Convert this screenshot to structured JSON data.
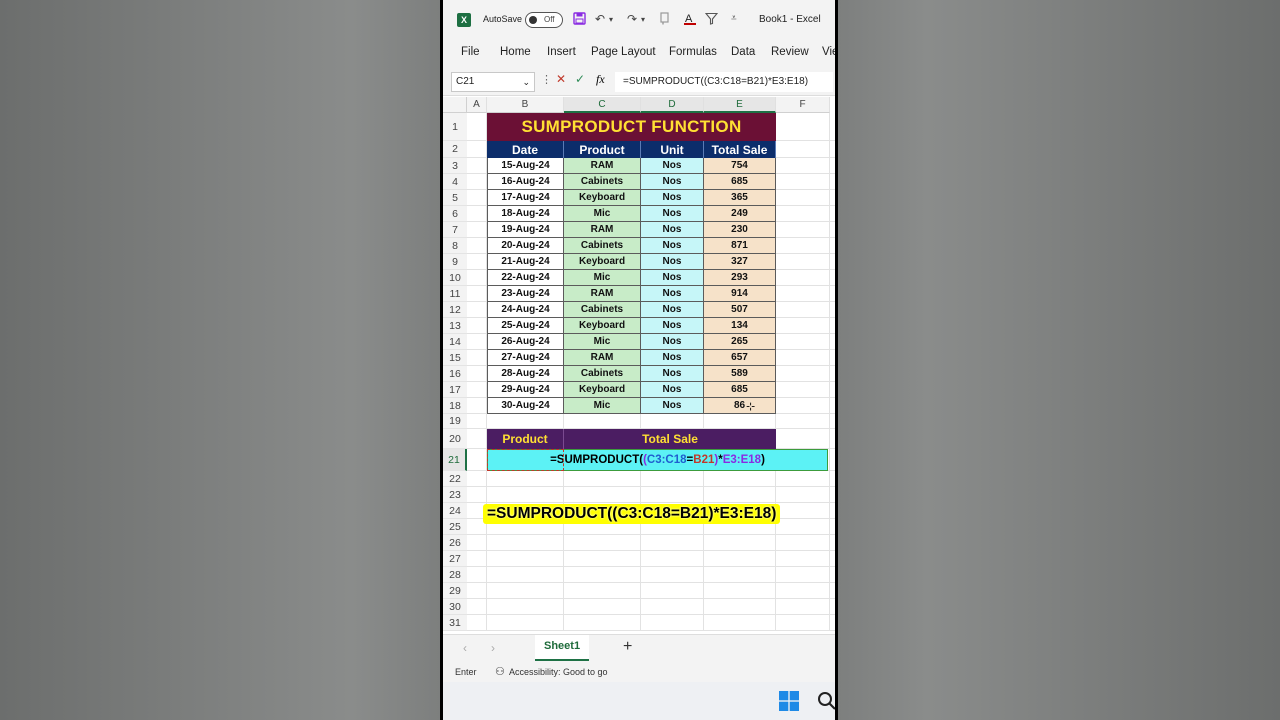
{
  "window": {
    "app_label": "X",
    "autosave_label": "AutoSave",
    "toggle_state": "Off",
    "title": "Book1  -  Excel"
  },
  "menu": [
    "File",
    "Home",
    "Insert",
    "Page Layout",
    "Formulas",
    "Data",
    "Review",
    "Vie"
  ],
  "formula_bar": {
    "name_box": "C21",
    "fx": "fx",
    "formula": "=SUMPRODUCT((C3:C18=B21)*E3:E18)"
  },
  "columns": [
    "A",
    "B",
    "C",
    "D",
    "E",
    "F"
  ],
  "rows": [
    "1",
    "2",
    "3",
    "4",
    "5",
    "6",
    "7",
    "8",
    "9",
    "10",
    "11",
    "12",
    "13",
    "14",
    "15",
    "16",
    "17",
    "18",
    "19",
    "20",
    "21",
    "22",
    "23",
    "24",
    "25",
    "26",
    "27",
    "28",
    "29",
    "30",
    "31"
  ],
  "sheet": {
    "title": "SUMPRODUCT FUNCTION",
    "headers": [
      "Date",
      "Product",
      "Unit",
      "Total Sale"
    ],
    "data": [
      [
        "15-Aug-24",
        "RAM",
        "Nos",
        "754"
      ],
      [
        "16-Aug-24",
        "Cabinets",
        "Nos",
        "685"
      ],
      [
        "17-Aug-24",
        "Keyboard",
        "Nos",
        "365"
      ],
      [
        "18-Aug-24",
        "Mic",
        "Nos",
        "249"
      ],
      [
        "19-Aug-24",
        "RAM",
        "Nos",
        "230"
      ],
      [
        "20-Aug-24",
        "Cabinets",
        "Nos",
        "871"
      ],
      [
        "21-Aug-24",
        "Keyboard",
        "Nos",
        "327"
      ],
      [
        "22-Aug-24",
        "Mic",
        "Nos",
        "293"
      ],
      [
        "23-Aug-24",
        "RAM",
        "Nos",
        "914"
      ],
      [
        "24-Aug-24",
        "Cabinets",
        "Nos",
        "507"
      ],
      [
        "25-Aug-24",
        "Keyboard",
        "Nos",
        "134"
      ],
      [
        "26-Aug-24",
        "Mic",
        "Nos",
        "265"
      ],
      [
        "27-Aug-24",
        "RAM",
        "Nos",
        "657"
      ],
      [
        "28-Aug-24",
        "Cabinets",
        "Nos",
        "589"
      ],
      [
        "29-Aug-24",
        "Keyboard",
        "Nos",
        "685"
      ],
      [
        "30-Aug-24",
        "Mic",
        "Nos",
        "86"
      ]
    ],
    "summary_headers": [
      "Product",
      "Total Sale"
    ],
    "formula_parts": [
      {
        "text": "=SUMPRODUCT(",
        "color": "#000000"
      },
      {
        "text": "(",
        "color": "#8a2be2"
      },
      {
        "text": "C3:C18",
        "color": "#1f5fcf"
      },
      {
        "text": "=",
        "color": "#000000"
      },
      {
        "text": "B21",
        "color": "#c0392b"
      },
      {
        "text": ")",
        "color": "#8a2be2"
      },
      {
        "text": "*",
        "color": "#000000"
      },
      {
        "text": "E3:E18",
        "color": "#8a2be2"
      },
      {
        "text": ")",
        "color": "#000000"
      }
    ],
    "overlay_formula": "=SUMPRODUCT((C3:C18=B21)*E3:E18)"
  },
  "sheet_tabs": {
    "active": "Sheet1",
    "add_label": "+"
  },
  "status": {
    "mode": "Enter",
    "accessibility": "Accessibility: Good to go"
  },
  "colors": {
    "title_bg": "#6b1035",
    "title_fg": "#ffe033",
    "header_bg": "#0c2d6b",
    "date_bg": "#ffffff",
    "product_bg": "#c8ecc8",
    "unit_bg": "#c6f6f8",
    "sale_bg": "#f6e2c9",
    "summary_bg": "#4b1d62",
    "formula_cell_bg": "#5cf2f5",
    "overlay_bg": "#ffff00"
  }
}
